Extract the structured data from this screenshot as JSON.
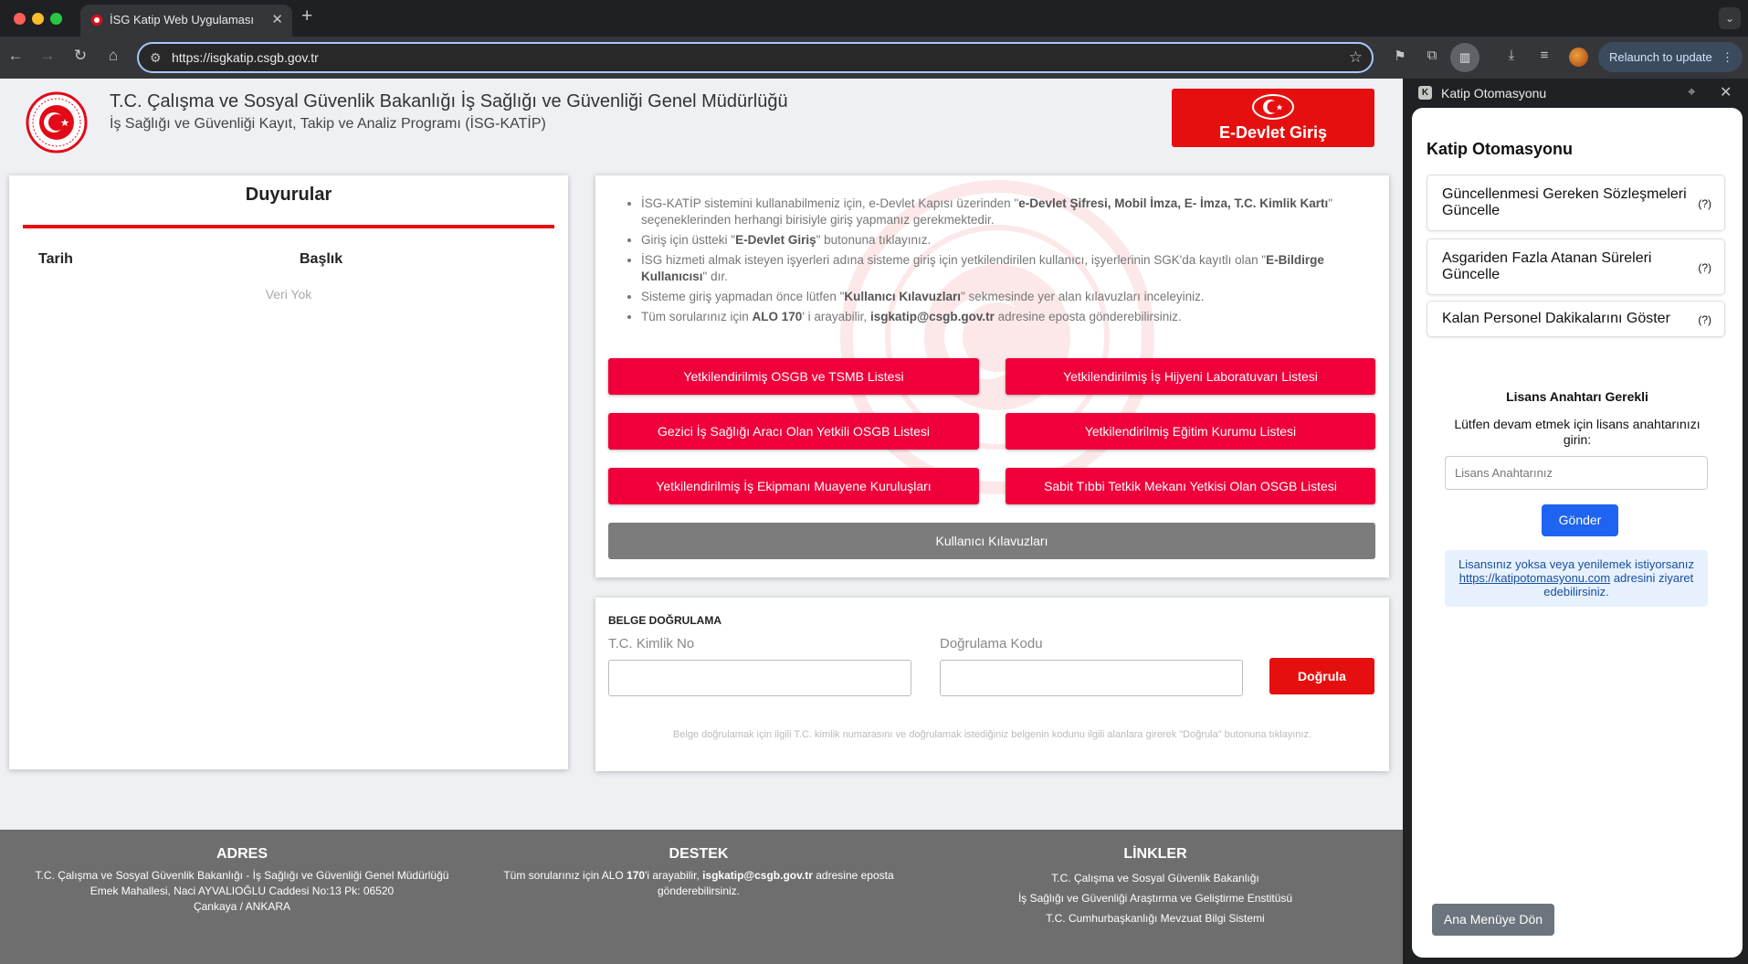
{
  "browser": {
    "tab_title": "İSG Katip Web Uygulaması",
    "url": "https://isgkatip.csgb.gov.tr",
    "relaunch_label": "Relaunch to update"
  },
  "header": {
    "ministry": "T.C. Çalışma ve Sosyal Güvenlik Bakanlığı İş Sağlığı ve Güvenliği Genel Müdürlüğü",
    "program": "İş Sağlığı ve Güvenliği Kayıt, Takip ve Analiz Programı (İSG-KATİP)",
    "edevlet_label": "E-Devlet Giriş"
  },
  "announcements": {
    "title": "Duyurular",
    "col_date": "Tarih",
    "col_title": "Başlık",
    "empty": "Veri Yok"
  },
  "info": {
    "b1_pre": "İSG-KATİP sistemini kullanabilmeniz için, e-Devlet Kapısı üzerinden \"",
    "b1_bold": "e-Devlet Şifresi, Mobil İmza, E- İmza, T.C. Kimlik Kartı",
    "b1_post": "\" seçeneklerinden herhangi birisiyle giriş yapmanız gerekmektedir.",
    "b2_pre": "Giriş için üstteki \"",
    "b2_bold": "E-Devlet Giriş",
    "b2_post": "\" butonuna tıklayınız.",
    "b3_pre": "İSG hizmeti almak isteyen işyerleri adına sisteme giriş için yetkilendirilen kullanıcı, işyerlerinin SGK'da kayıtlı olan \"",
    "b3_bold": "E-Bildirge Kullanıcısı",
    "b3_post": "\" dır.",
    "b4_pre": "Sisteme giriş yapmadan önce lütfen \"",
    "b4_bold": "Kullanıcı Kılavuzları",
    "b4_post": "\" sekmesinde yer alan kılavuzları inceleyiniz.",
    "b5_pre": "Tüm sorularınız için ",
    "b5_bold": "ALO 170",
    "b5_mid": "' i arayabilir, ",
    "b5_bold2": "isgkatip@csgb.gov.tr",
    "b5_post": " adresine eposta gönderebilirsiniz.",
    "buttons": [
      "Yetkilendirilmiş OSGB ve TSMB Listesi",
      "Yetkilendirilmiş İş Hijyeni Laboratuvarı Listesi",
      "Gezici İş Sağlığı Aracı Olan Yetkili OSGB Listesi",
      "Yetkilendirilmiş Eğitim Kurumu Listesi",
      "Yetkilendirilmiş İş Ekipmanı Muayene Kuruluşları",
      "Sabit Tıbbi Tetkik Mekanı Yetkisi Olan OSGB Listesi"
    ],
    "guides_label": "Kullanıcı Kılavuzları"
  },
  "verify": {
    "title": "BELGE DOĞRULAMA",
    "tc_label": "T.C. Kimlik No",
    "code_label": "Doğrulama Kodu",
    "button": "Doğrula",
    "hint": "Belge doğrulamak için ilgili T.C. kimlik numarasını ve doğrulamak istediğiniz belgenin kodunu ilgili alanlara girerek \"Doğrula\" butonuna tıklayınız."
  },
  "footer": {
    "address_title": "ADRES",
    "address_l1": "T.C. Çalışma ve Sosyal Güvenlik Bakanlığı - İş Sağlığı ve Güvenliği Genel Müdürlüğü",
    "address_l2": "Emek Mahallesi, Naci AYVALIOĞLU Caddesi No:13 Pk: 06520",
    "address_l3": "Çankaya / ANKARA",
    "support_title": "DESTEK",
    "support_pre": "Tüm sorularınız için ALO ",
    "support_num": "170",
    "support_mid": "'i arayabilir,  ",
    "support_email": "isgkatip@csgb.gov.tr",
    "support_post": " adresine eposta gönderebilirsiniz.",
    "links_title": "LİNKLER",
    "links": [
      "T.C. Çalışma ve Sosyal Güvenlik Bakanlığı",
      "İş Sağlığı ve Güvenliği Araştırma ve Geliştirme Enstitüsü",
      "T.C. Cumhurbaşkanlığı Mevzuat Bilgi Sistemi"
    ]
  },
  "side": {
    "header_title": "Katip Otomasyonu",
    "header_letter": "K",
    "title": "Katip Otomasyonu",
    "buttons": [
      "Güncellenmesi Gereken Sözleşmeleri Güncelle",
      "Asgariden Fazla Atanan Süreleri Güncelle",
      "Kalan Personel Dakikalarını Göster"
    ],
    "help": "(?)",
    "license_title": "Lisans Anahtarı Gerekli",
    "license_desc": "Lütfen devam etmek için lisans anahtarınızı girin:",
    "license_placeholder": "Lisans Anahtarınız",
    "send": "Gönder",
    "info_pre": "Lisansınız yoksa veya yenilemek istiyorsanız ",
    "info_link": "https://katipotomasyonu.com",
    "info_post": " adresini ziyaret edebilirsiniz.",
    "back": "Ana Menüye Dön"
  },
  "colors": {
    "brand_red": "#e60f0f",
    "button_red": "#f0003a",
    "side_blue": "#1e64f0"
  }
}
